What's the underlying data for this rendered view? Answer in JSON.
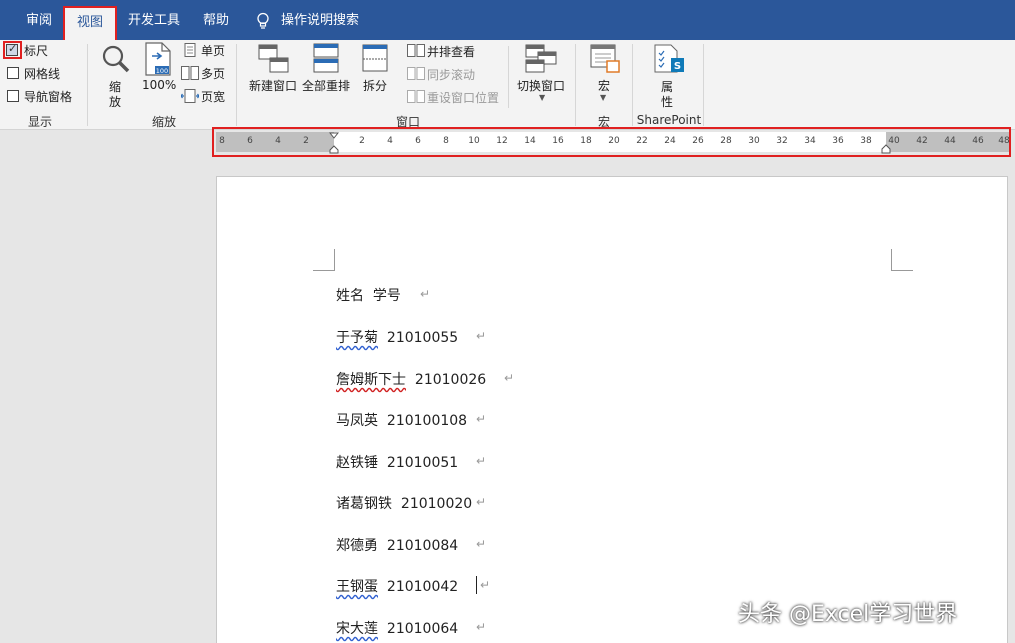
{
  "tabs": [
    {
      "label": "审阅",
      "active": false
    },
    {
      "label": "视图",
      "active": true
    },
    {
      "label": "开发工具",
      "active": false
    },
    {
      "label": "帮助",
      "active": false
    }
  ],
  "tell_me": "操作说明搜索",
  "ribbon": {
    "show": {
      "label": "显示",
      "ruler": {
        "label": "标尺",
        "checked": true
      },
      "gridlines": {
        "label": "网格线",
        "checked": false
      },
      "nav_pane": {
        "label": "导航窗格",
        "checked": false
      }
    },
    "zoom": {
      "label": "缩放",
      "zoom_btn": [
        "缩",
        "放"
      ],
      "zoom100": "100%",
      "one_page": "单页",
      "multi_page": "多页",
      "page_width": "页宽"
    },
    "window": {
      "label": "窗口",
      "new_window": "新建窗口",
      "arrange_all": "全部重排",
      "split": "拆分",
      "side_by_side": "并排查看",
      "sync_scroll": "同步滚动",
      "reset_pos": "重设窗口位置",
      "switch_windows": "切换窗口"
    },
    "macros": {
      "label": "宏",
      "btn": "宏"
    },
    "sharepoint": {
      "label": "SharePoint",
      "btn": [
        "属",
        "性"
      ]
    }
  },
  "ruler": {
    "left_ticks": [
      "8",
      "6",
      "4",
      "2"
    ],
    "mid_ticks": [
      "2",
      "4",
      "6",
      "8",
      "10",
      "12",
      "14",
      "16",
      "18",
      "20",
      "22",
      "24",
      "26",
      "28",
      "30",
      "32",
      "34",
      "36",
      "38"
    ],
    "right_ticks": [
      "40",
      "42",
      "44",
      "46",
      "48"
    ]
  },
  "document": {
    "lines": [
      {
        "name": "姓名",
        "id": "学号"
      },
      {
        "name": "于予菊",
        "id": "21010055"
      },
      {
        "name": "詹姆斯下士",
        "id": "21010026"
      },
      {
        "name": "马凤英",
        "id": "210100108"
      },
      {
        "name": "赵铁锤",
        "id": "21010051"
      },
      {
        "name": "诸葛钢铁",
        "id": "21010020"
      },
      {
        "name": "郑德勇",
        "id": "21010084"
      },
      {
        "name": "王钢蛋",
        "id": "21010042"
      },
      {
        "name": "宋大莲",
        "id": "21010064"
      }
    ],
    "para_mark": "↵"
  },
  "watermark": "头条 @Excel学习世界"
}
